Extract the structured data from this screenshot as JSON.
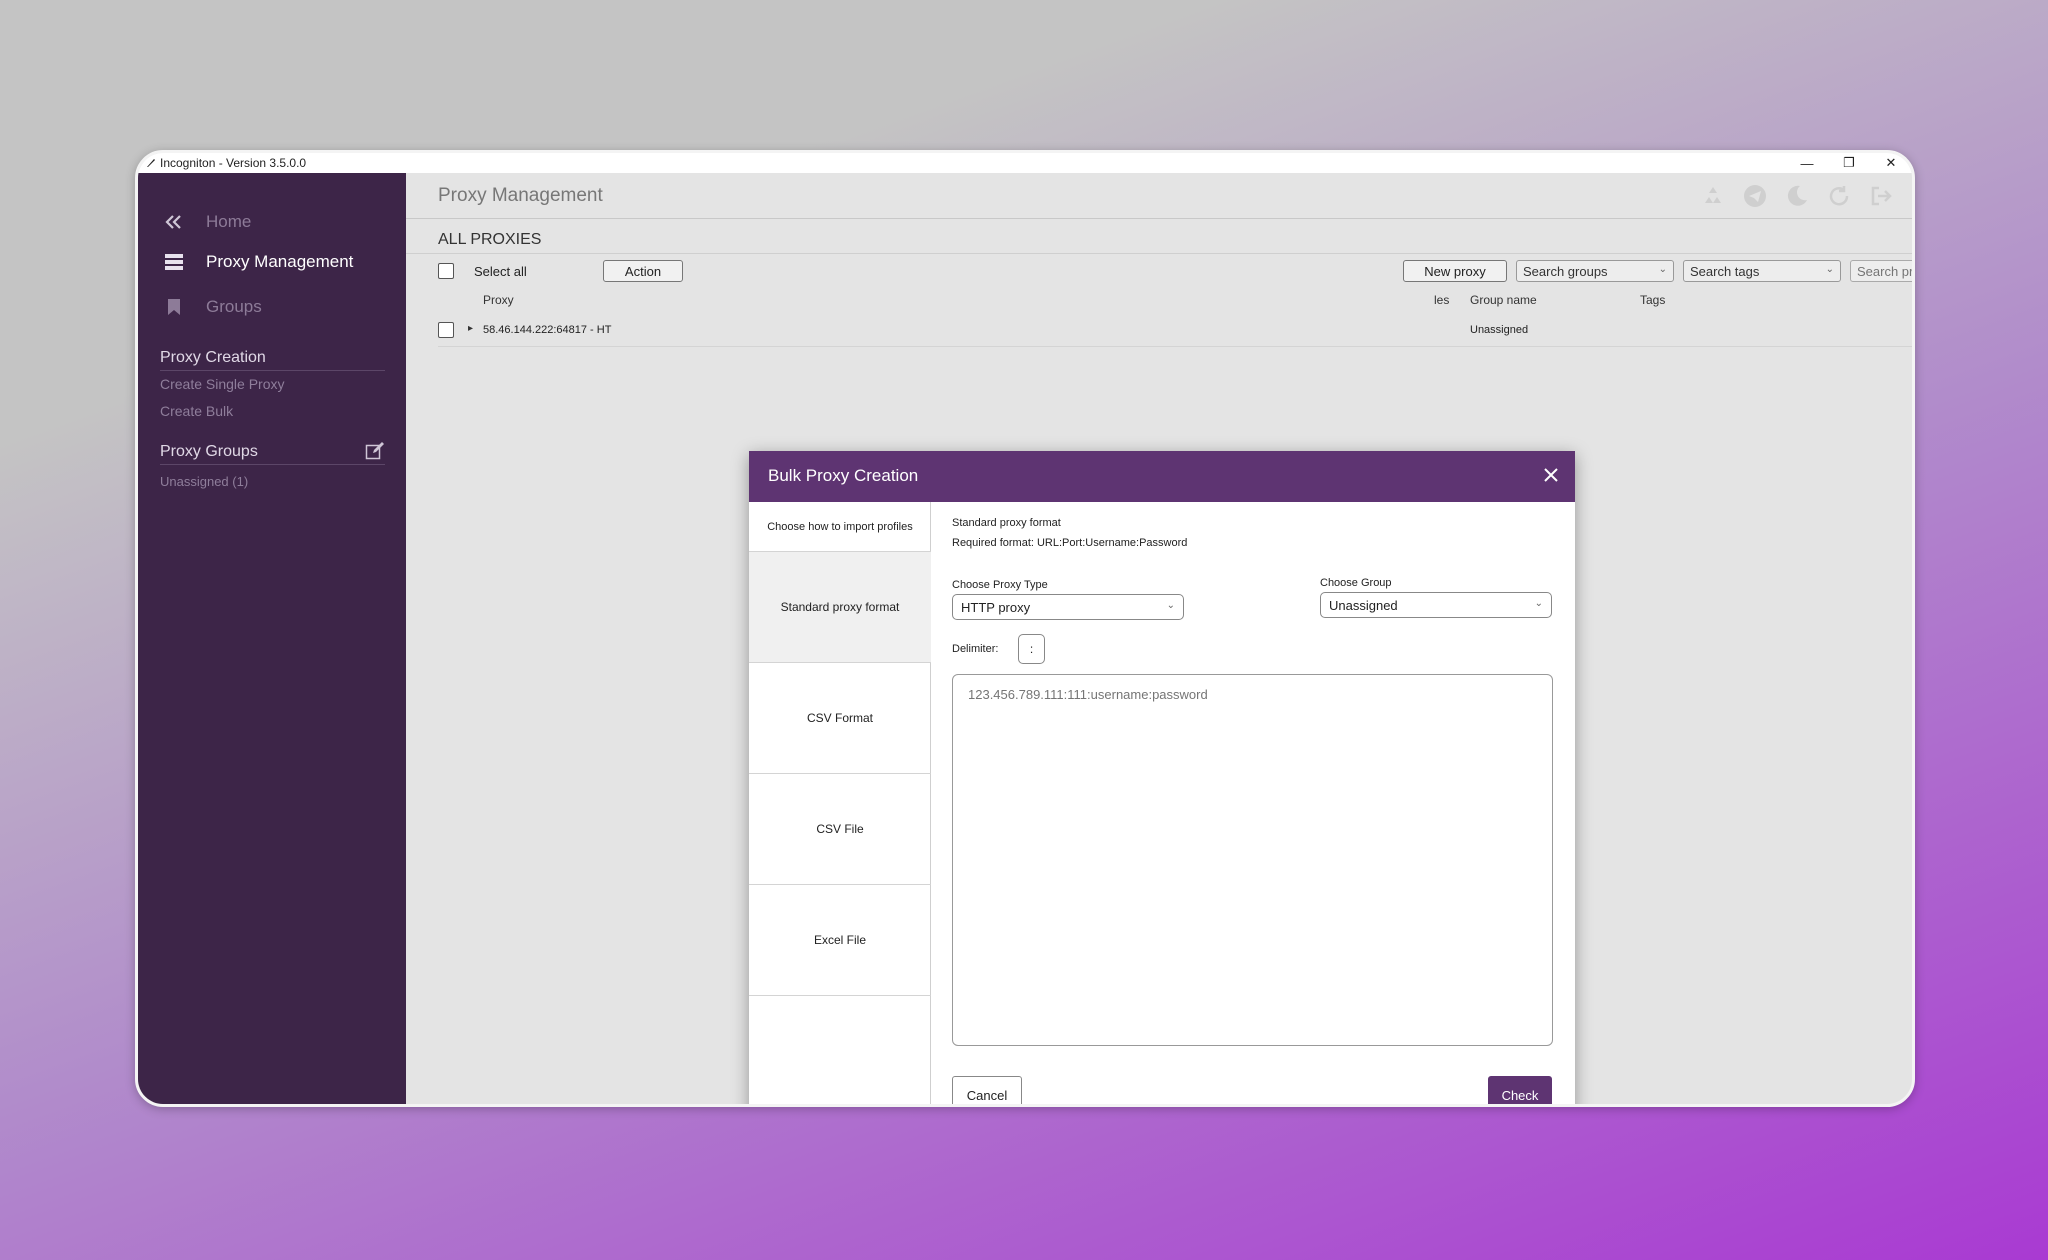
{
  "window": {
    "title": "Incogniton - Version 3.5.0.0",
    "controls": {
      "minimize": "—",
      "restore": "❐",
      "close": "✕"
    }
  },
  "sidebar": {
    "collapse_icon": "double-chevron-left-icon",
    "nav": [
      {
        "label": "Home",
        "icon": "double-chevron-left-icon",
        "active": false
      },
      {
        "label": "Proxy Management",
        "icon": "list-icon",
        "active": true
      },
      {
        "label": "Groups",
        "icon": "bookmark-icon",
        "active": false
      }
    ],
    "proxy_creation": {
      "title": "Proxy Creation",
      "links": [
        "Create Single Proxy",
        "Create Bulk"
      ]
    },
    "proxy_groups": {
      "title": "Proxy Groups",
      "edit_icon": "edit-icon",
      "items": [
        "Unassigned (1)"
      ]
    }
  },
  "main": {
    "title": "Proxy Management",
    "header_icons": [
      "recycle-icon",
      "telegram-icon",
      "moon-icon",
      "refresh-icon",
      "logout-icon"
    ],
    "section_title": "ALL PROXIES",
    "toolbar": {
      "select_all": "Select all",
      "action": "Action",
      "new_proxy": "New proxy",
      "search_groups": "Search groups",
      "search_tags": "Search tags",
      "search_proxies_placeholder": "Search proxies"
    },
    "table": {
      "columns": {
        "proxy": "Proxy",
        "profiles_partial": "les",
        "group_name": "Group name",
        "tags": "Tags"
      },
      "rows": [
        {
          "proxy": "58.46.144.222:64817 - HT",
          "group_name": "Unassigned",
          "tags": ""
        }
      ]
    }
  },
  "dialog": {
    "title": "Bulk Proxy Creation",
    "close": "✕",
    "left_heading": "Choose how to import profiles",
    "tabs": [
      "Standard proxy format",
      "CSV Format",
      "CSV File",
      "Excel File"
    ],
    "active_tab": 0,
    "format_title": "Standard proxy format",
    "format_required": "Required format: URL:Port:Username:Password",
    "proxy_type_label": "Choose Proxy Type",
    "proxy_type_value": "HTTP proxy",
    "group_label": "Choose Group",
    "group_value": "Unassigned",
    "delimiter_label": "Delimiter:",
    "delimiter_value": ":",
    "textarea_placeholder": "123.456.789.111:111:username:password",
    "cancel": "Cancel",
    "check": "Check"
  },
  "colors": {
    "sidebar_bg": "#3d2548",
    "accent": "#5e3472"
  }
}
